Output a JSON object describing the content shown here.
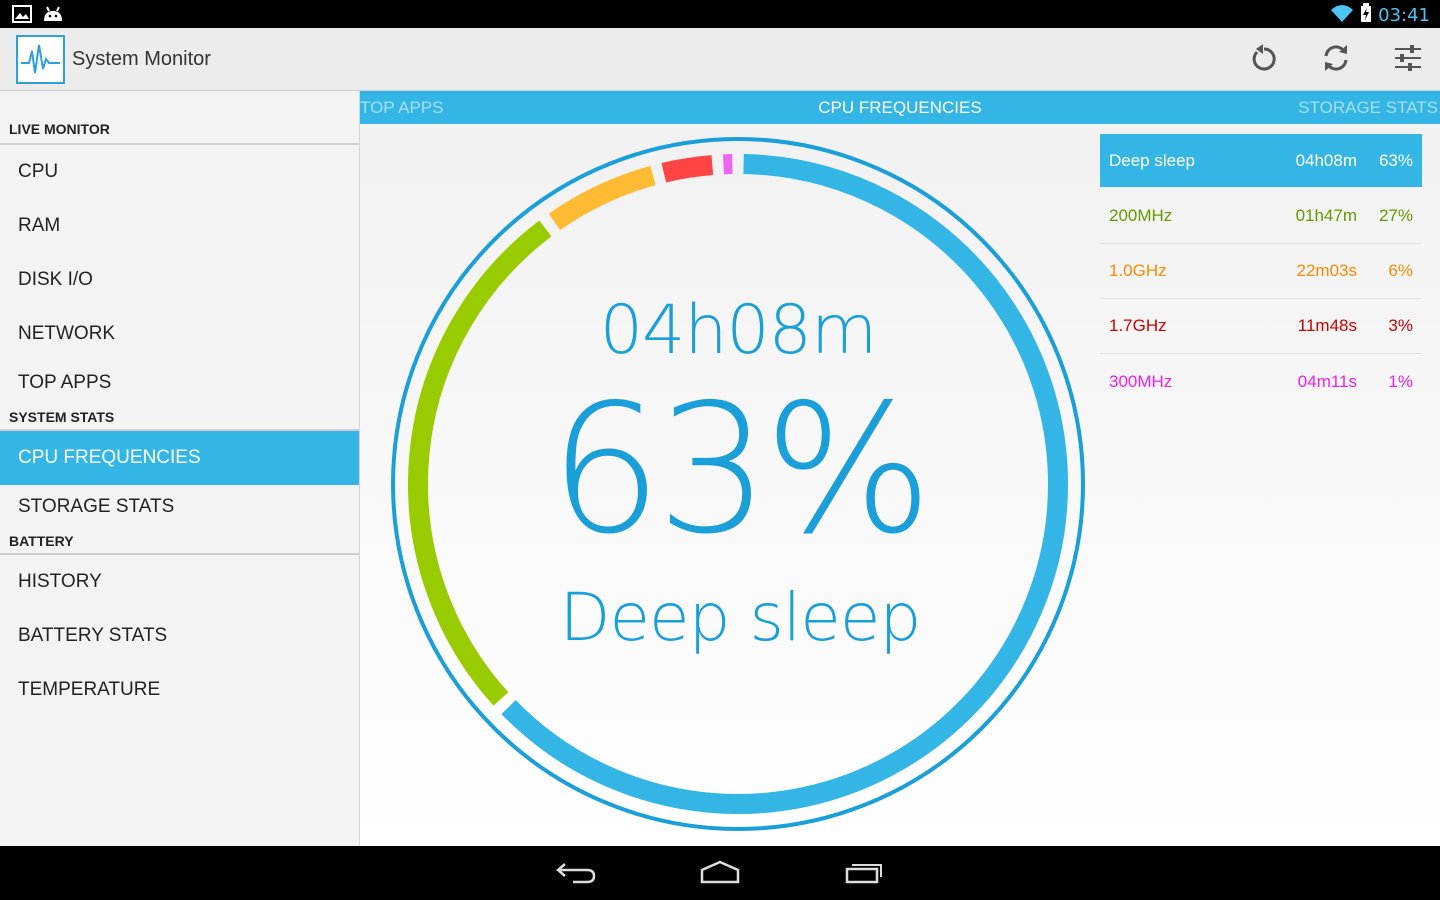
{
  "status_bar": {
    "time": "03:41",
    "icons": [
      "image-icon",
      "android-icon",
      "wifi-icon",
      "battery-charging-icon"
    ]
  },
  "action_bar": {
    "title": "System Monitor",
    "actions": [
      "reset-icon",
      "refresh-icon",
      "settings-sliders-icon"
    ]
  },
  "sidebar": {
    "sections": [
      {
        "header": "LIVE MONITOR",
        "items": [
          "CPU",
          "RAM",
          "DISK I/O",
          "NETWORK",
          "TOP APPS"
        ]
      },
      {
        "header": "SYSTEM STATS",
        "items": [
          "CPU FREQUENCIES",
          "STORAGE STATS"
        ]
      },
      {
        "header": "BATTERY",
        "items": [
          "HISTORY",
          "BATTERY STATS",
          "TEMPERATURE"
        ]
      }
    ],
    "active_item": "CPU FREQUENCIES"
  },
  "tabs": {
    "left": "TOP APPS",
    "center": "CPU FREQUENCIES",
    "right": "STORAGE STATS"
  },
  "gauge": {
    "time": "04h08m",
    "percent": "63%",
    "state": "Deep sleep",
    "segments": [
      {
        "name": "Deep sleep",
        "fraction": 0.63,
        "color": "#33b5e5"
      },
      {
        "name": "200MHz",
        "fraction": 0.27,
        "color": "#99cc00"
      },
      {
        "name": "1.0GHz",
        "fraction": 0.06,
        "color": "#ffbb33"
      },
      {
        "name": "1.7GHz",
        "fraction": 0.03,
        "color": "#ff4444"
      },
      {
        "name": "300MHz",
        "fraction": 0.01,
        "color": "#ee66ee"
      }
    ]
  },
  "frequencies": [
    {
      "name": "Deep sleep",
      "time": "04h08m",
      "percent": "63%",
      "color": "#ffffff",
      "selected": true
    },
    {
      "name": "200MHz",
      "time": "01h47m",
      "percent": "27%",
      "color": "#669900",
      "selected": false
    },
    {
      "name": "1.0GHz",
      "time": "22m03s",
      "percent": "6%",
      "color": "#ff8800",
      "selected": false
    },
    {
      "name": "1.7GHz",
      "time": "11m48s",
      "percent": "3%",
      "color": "#cc0000",
      "selected": false
    },
    {
      "name": "300MHz",
      "time": "04m11s",
      "percent": "1%",
      "color": "#ee22ee",
      "selected": false
    }
  ],
  "nav_bar": {
    "buttons": [
      "back-icon",
      "home-icon",
      "recents-icon"
    ]
  }
}
